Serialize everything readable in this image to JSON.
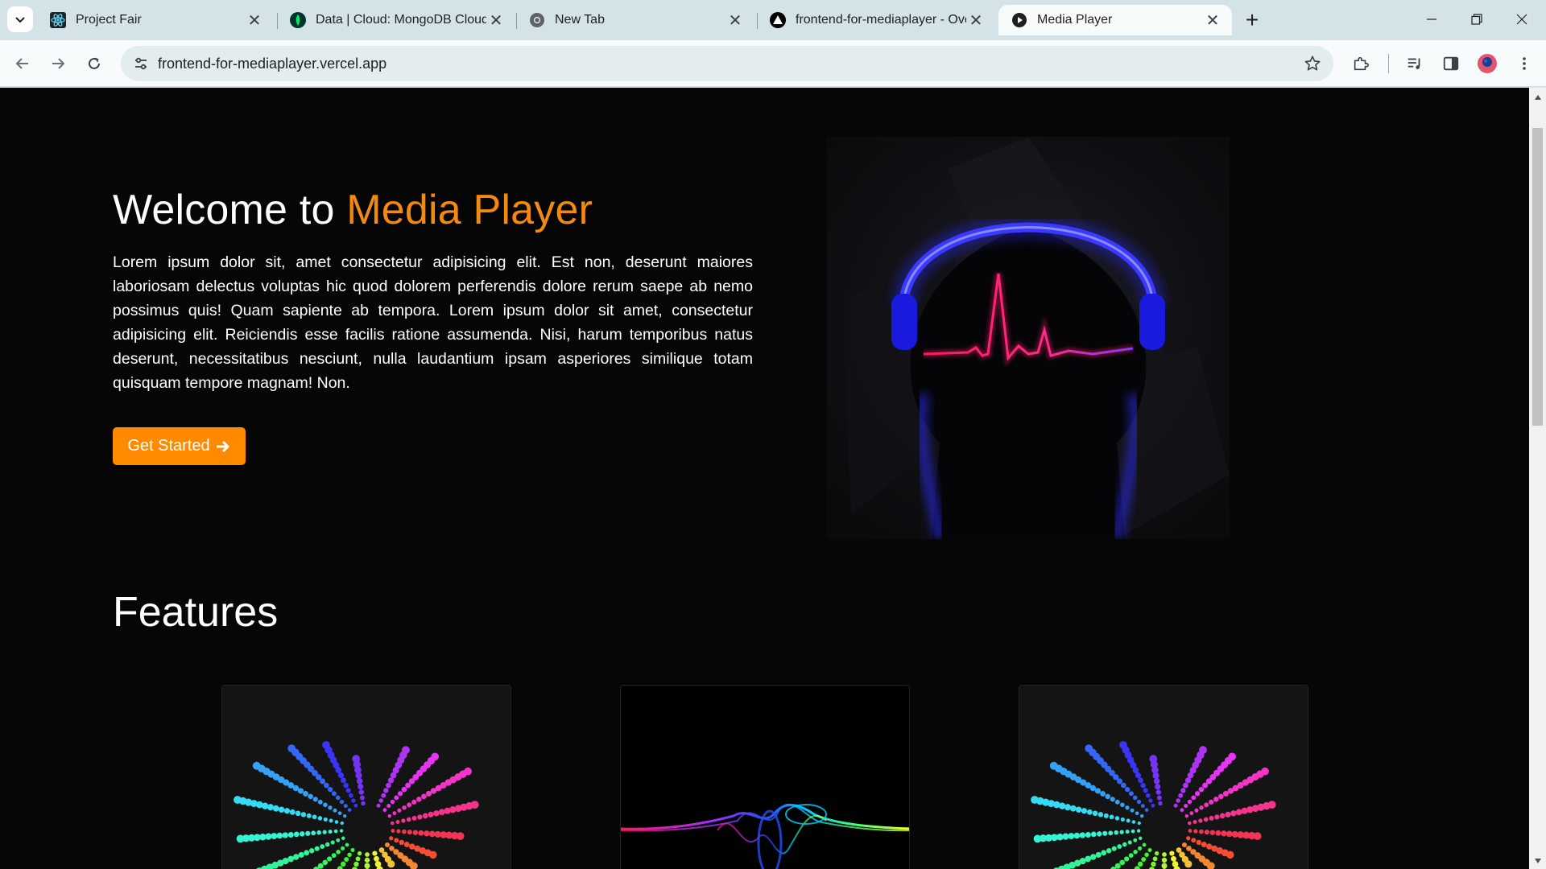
{
  "browser": {
    "tabs": [
      {
        "title": "Project Fair",
        "favicon": "react-icon"
      },
      {
        "title": "Data | Cloud: MongoDB Cloud",
        "favicon": "mongodb-leaf-icon"
      },
      {
        "title": "New Tab",
        "favicon": "chrome-icon"
      },
      {
        "title": "frontend-for-mediaplayer - Ove",
        "favicon": "vercel-triangle-icon"
      },
      {
        "title": "Media Player",
        "favicon": "play-icon",
        "active": true
      }
    ],
    "url": "frontend-for-mediaplayer.vercel.app"
  },
  "page": {
    "hero": {
      "title_prefix": "Welcome to ",
      "title_accent": "Media Player",
      "description": "Lorem ipsum dolor sit, amet consectetur adipisicing elit. Est non, deserunt maiores laboriosam delectus voluptas hic quod dolorem perferendis dolore rerum saepe ab nemo possimus quis! Quam sapiente ab tempora. Lorem ipsum dolor sit amet, consectetur adipisicing elit. Reiciendis esse facilis ratione assumenda. Nisi, harum temporibus natus deserunt, necessitatibus nesciunt, nulla laudantium ipsam asperiores similique totam quisquam tempore magnam! Non.",
      "cta_label": "Get Started",
      "cta_icon": "arrow-right-icon"
    },
    "features": {
      "title": "Features",
      "cards": [
        {
          "image": "radial-equalizer-image"
        },
        {
          "image": "sound-wave-image"
        },
        {
          "image": "radial-equalizer-image"
        }
      ]
    }
  },
  "colors": {
    "accent": "#f28a0f",
    "button": "#ff8a00",
    "page_background": "#060606",
    "tabstrip": "#d3e3e8"
  }
}
